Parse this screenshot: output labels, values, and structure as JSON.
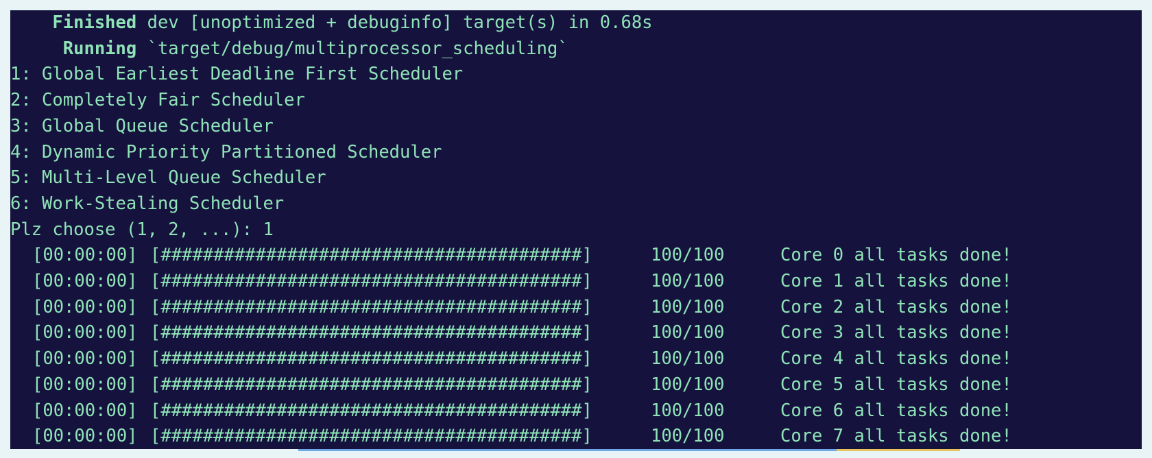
{
  "terminal": {
    "build": {
      "finished_status": "Finished",
      "finished_text": "dev [unoptimized + debuginfo] target(s) in 0.68s",
      "running_status": "Running",
      "running_text": "`target/debug/multiprocessor_scheduling`"
    },
    "menu": [
      "1: Global Earliest Deadline First Scheduler",
      "2: Completely Fair Scheduler",
      "3: Global Queue Scheduler",
      "4: Dynamic Priority Partitioned Scheduler",
      "5: Multi-Level Queue Scheduler",
      "6: Work-Stealing Scheduler"
    ],
    "prompt": "Plz choose (1, 2, ...): 1",
    "progress": [
      {
        "elapsed": "[00:00:00]",
        "bar": "[########################################]",
        "progress": 1.0,
        "count": "100/100",
        "message": "Core 0 all tasks done!"
      },
      {
        "elapsed": "[00:00:00]",
        "bar": "[########################################]",
        "progress": 1.0,
        "count": "100/100",
        "message": "Core 1 all tasks done!"
      },
      {
        "elapsed": "[00:00:00]",
        "bar": "[########################################]",
        "progress": 1.0,
        "count": "100/100",
        "message": "Core 2 all tasks done!"
      },
      {
        "elapsed": "[00:00:00]",
        "bar": "[########################################]",
        "progress": 1.0,
        "count": "100/100",
        "message": "Core 3 all tasks done!"
      },
      {
        "elapsed": "[00:00:00]",
        "bar": "[########################################]",
        "progress": 1.0,
        "count": "100/100",
        "message": "Core 4 all tasks done!"
      },
      {
        "elapsed": "[00:00:00]",
        "bar": "[########################################]",
        "progress": 1.0,
        "count": "100/100",
        "message": "Core 5 all tasks done!"
      },
      {
        "elapsed": "[00:00:00]",
        "bar": "[########################################]",
        "progress": 1.0,
        "count": "100/100",
        "message": "Core 6 all tasks done!"
      },
      {
        "elapsed": "[00:00:00]",
        "bar": "[########################################]",
        "progress": 1.0,
        "count": "100/100",
        "message": "Core 7 all tasks done!"
      }
    ],
    "colors": {
      "background": "#15123e",
      "foreground": "#8fe3b7"
    }
  }
}
